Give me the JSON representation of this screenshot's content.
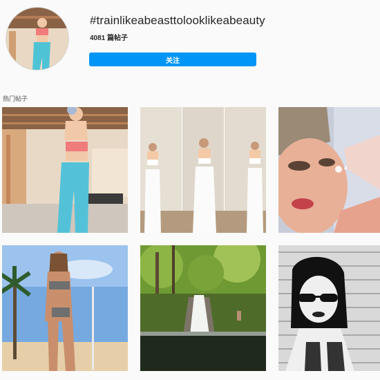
{
  "hashtag": {
    "title": "#trainlikeabeasttolooklikeabeauty",
    "post_count": "4081 篇帖子",
    "follow_label": "关注"
  },
  "sections": {
    "top_posts_label": "热门帖子"
  },
  "posts": [
    {
      "scene": "gym-basement-woman-blue-leggings",
      "comments": ""
    },
    {
      "scene": "mirror-selfie-white-outfit-triptych",
      "comments": ""
    },
    {
      "scene": "selfie-woman-red-lips",
      "comments": "4"
    },
    {
      "scene": "beach-woman-grey-bikini-palm",
      "comments": ""
    },
    {
      "scene": "waterfall-forest-pool",
      "comments": ""
    },
    {
      "scene": "mugshot-woman-sunglasses-bw",
      "comments": ""
    }
  ],
  "colors": {
    "accent": "#0095f6",
    "background": "#fafafa"
  },
  "icons": {
    "comment": "comment-bubble-icon"
  }
}
